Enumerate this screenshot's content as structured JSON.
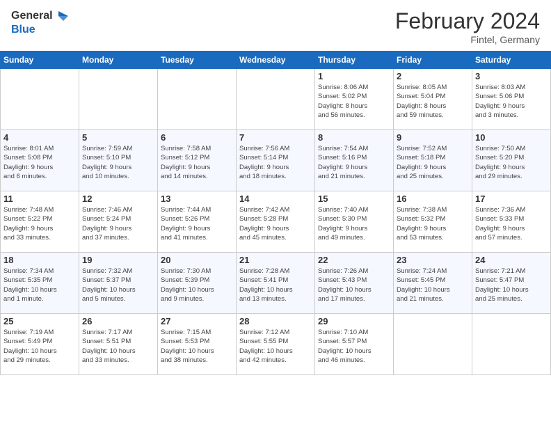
{
  "header": {
    "logo_text_general": "General",
    "logo_text_blue": "Blue",
    "month_year": "February 2024",
    "location": "Fintel, Germany"
  },
  "weekdays": [
    "Sunday",
    "Monday",
    "Tuesday",
    "Wednesday",
    "Thursday",
    "Friday",
    "Saturday"
  ],
  "weeks": [
    [
      {
        "day": "",
        "info": ""
      },
      {
        "day": "",
        "info": ""
      },
      {
        "day": "",
        "info": ""
      },
      {
        "day": "",
        "info": ""
      },
      {
        "day": "1",
        "info": "Sunrise: 8:06 AM\nSunset: 5:02 PM\nDaylight: 8 hours\nand 56 minutes."
      },
      {
        "day": "2",
        "info": "Sunrise: 8:05 AM\nSunset: 5:04 PM\nDaylight: 8 hours\nand 59 minutes."
      },
      {
        "day": "3",
        "info": "Sunrise: 8:03 AM\nSunset: 5:06 PM\nDaylight: 9 hours\nand 3 minutes."
      }
    ],
    [
      {
        "day": "4",
        "info": "Sunrise: 8:01 AM\nSunset: 5:08 PM\nDaylight: 9 hours\nand 6 minutes."
      },
      {
        "day": "5",
        "info": "Sunrise: 7:59 AM\nSunset: 5:10 PM\nDaylight: 9 hours\nand 10 minutes."
      },
      {
        "day": "6",
        "info": "Sunrise: 7:58 AM\nSunset: 5:12 PM\nDaylight: 9 hours\nand 14 minutes."
      },
      {
        "day": "7",
        "info": "Sunrise: 7:56 AM\nSunset: 5:14 PM\nDaylight: 9 hours\nand 18 minutes."
      },
      {
        "day": "8",
        "info": "Sunrise: 7:54 AM\nSunset: 5:16 PM\nDaylight: 9 hours\nand 21 minutes."
      },
      {
        "day": "9",
        "info": "Sunrise: 7:52 AM\nSunset: 5:18 PM\nDaylight: 9 hours\nand 25 minutes."
      },
      {
        "day": "10",
        "info": "Sunrise: 7:50 AM\nSunset: 5:20 PM\nDaylight: 9 hours\nand 29 minutes."
      }
    ],
    [
      {
        "day": "11",
        "info": "Sunrise: 7:48 AM\nSunset: 5:22 PM\nDaylight: 9 hours\nand 33 minutes."
      },
      {
        "day": "12",
        "info": "Sunrise: 7:46 AM\nSunset: 5:24 PM\nDaylight: 9 hours\nand 37 minutes."
      },
      {
        "day": "13",
        "info": "Sunrise: 7:44 AM\nSunset: 5:26 PM\nDaylight: 9 hours\nand 41 minutes."
      },
      {
        "day": "14",
        "info": "Sunrise: 7:42 AM\nSunset: 5:28 PM\nDaylight: 9 hours\nand 45 minutes."
      },
      {
        "day": "15",
        "info": "Sunrise: 7:40 AM\nSunset: 5:30 PM\nDaylight: 9 hours\nand 49 minutes."
      },
      {
        "day": "16",
        "info": "Sunrise: 7:38 AM\nSunset: 5:32 PM\nDaylight: 9 hours\nand 53 minutes."
      },
      {
        "day": "17",
        "info": "Sunrise: 7:36 AM\nSunset: 5:33 PM\nDaylight: 9 hours\nand 57 minutes."
      }
    ],
    [
      {
        "day": "18",
        "info": "Sunrise: 7:34 AM\nSunset: 5:35 PM\nDaylight: 10 hours\nand 1 minute."
      },
      {
        "day": "19",
        "info": "Sunrise: 7:32 AM\nSunset: 5:37 PM\nDaylight: 10 hours\nand 5 minutes."
      },
      {
        "day": "20",
        "info": "Sunrise: 7:30 AM\nSunset: 5:39 PM\nDaylight: 10 hours\nand 9 minutes."
      },
      {
        "day": "21",
        "info": "Sunrise: 7:28 AM\nSunset: 5:41 PM\nDaylight: 10 hours\nand 13 minutes."
      },
      {
        "day": "22",
        "info": "Sunrise: 7:26 AM\nSunset: 5:43 PM\nDaylight: 10 hours\nand 17 minutes."
      },
      {
        "day": "23",
        "info": "Sunrise: 7:24 AM\nSunset: 5:45 PM\nDaylight: 10 hours\nand 21 minutes."
      },
      {
        "day": "24",
        "info": "Sunrise: 7:21 AM\nSunset: 5:47 PM\nDaylight: 10 hours\nand 25 minutes."
      }
    ],
    [
      {
        "day": "25",
        "info": "Sunrise: 7:19 AM\nSunset: 5:49 PM\nDaylight: 10 hours\nand 29 minutes."
      },
      {
        "day": "26",
        "info": "Sunrise: 7:17 AM\nSunset: 5:51 PM\nDaylight: 10 hours\nand 33 minutes."
      },
      {
        "day": "27",
        "info": "Sunrise: 7:15 AM\nSunset: 5:53 PM\nDaylight: 10 hours\nand 38 minutes."
      },
      {
        "day": "28",
        "info": "Sunrise: 7:12 AM\nSunset: 5:55 PM\nDaylight: 10 hours\nand 42 minutes."
      },
      {
        "day": "29",
        "info": "Sunrise: 7:10 AM\nSunset: 5:57 PM\nDaylight: 10 hours\nand 46 minutes."
      },
      {
        "day": "",
        "info": ""
      },
      {
        "day": "",
        "info": ""
      }
    ]
  ]
}
